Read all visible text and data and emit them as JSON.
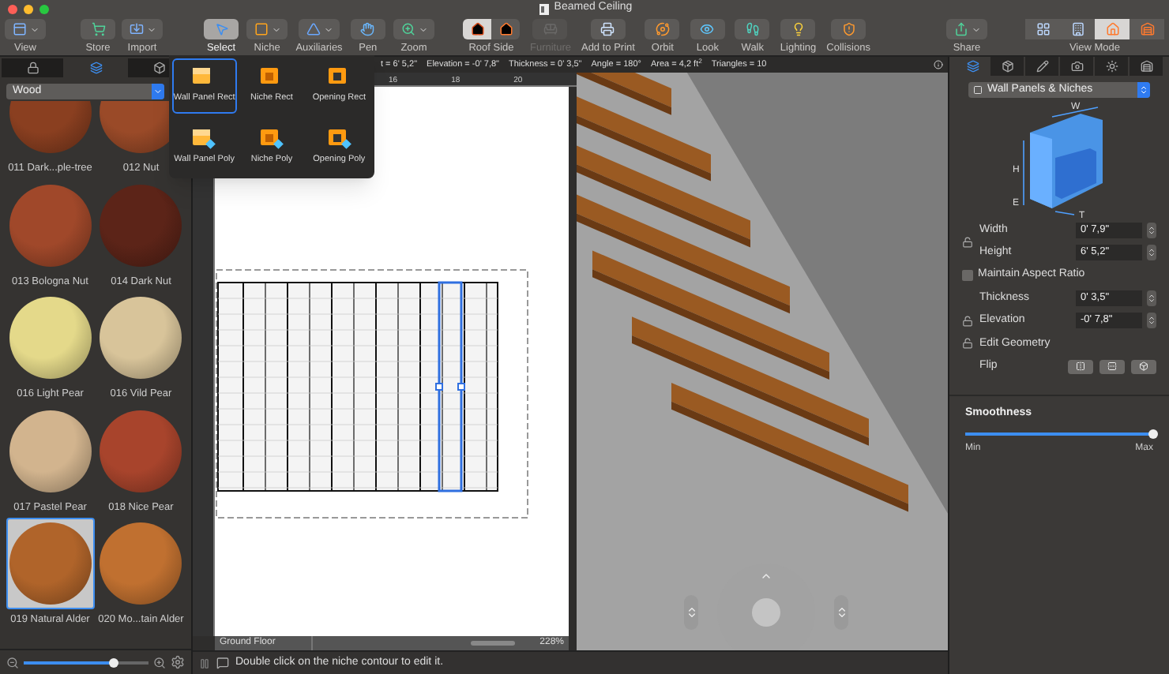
{
  "window": {
    "title": "Beamed Ceiling"
  },
  "toolbar_groups": [
    [
      {
        "label": "View",
        "kind": "view",
        "selected": false,
        "disabled": false
      }
    ],
    [
      {
        "label": "Store",
        "kind": "store",
        "selected": false,
        "disabled": false
      },
      {
        "label": "Import",
        "kind": "import",
        "selected": false,
        "disabled": false
      }
    ],
    [
      {
        "label": "Select",
        "kind": "select",
        "selected": true,
        "disabled": false
      },
      {
        "label": "Niche",
        "kind": "niche",
        "selected": false,
        "disabled": false
      },
      {
        "label": "Auxiliaries",
        "kind": "aux",
        "selected": false,
        "disabled": false
      },
      {
        "label": "Pen",
        "kind": "pen",
        "selected": false,
        "disabled": false
      },
      {
        "label": "Zoom",
        "kind": "zoom",
        "selected": false,
        "disabled": false
      }
    ],
    [
      {
        "label": "Roof Side",
        "kind": "roof",
        "selected": false,
        "disabled": false
      },
      {
        "label": "Furniture",
        "kind": "furniture",
        "selected": false,
        "disabled": true
      },
      {
        "label": "Add to Print",
        "kind": "print",
        "selected": false,
        "disabled": false
      },
      {
        "label": "Orbit",
        "kind": "orbit",
        "selected": false,
        "disabled": false
      },
      {
        "label": "Look",
        "kind": "look",
        "selected": false,
        "disabled": false
      },
      {
        "label": "Walk",
        "kind": "walk",
        "selected": false,
        "disabled": false
      },
      {
        "label": "Lighting",
        "kind": "lighting",
        "selected": false,
        "disabled": false
      },
      {
        "label": "Collisions",
        "kind": "collisions",
        "selected": false,
        "disabled": false
      }
    ],
    [
      {
        "label": "Share",
        "kind": "share",
        "selected": false,
        "disabled": false
      }
    ],
    [
      {
        "label": "View Mode",
        "kind": "viewmode",
        "selected": false,
        "disabled": false,
        "modes": [
          {
            "selected": false
          },
          {
            "selected": false
          },
          {
            "selected": true
          },
          {
            "selected": false
          }
        ]
      }
    ]
  ],
  "tool_popup": {
    "items": [
      {
        "label": "Wall Panel Rect",
        "kind": "panel",
        "polygon": false,
        "selected": true
      },
      {
        "label": "Niche Rect",
        "kind": "niche",
        "polygon": false,
        "selected": false
      },
      {
        "label": "Opening Rect",
        "kind": "opening",
        "polygon": false,
        "selected": false
      },
      {
        "label": "Wall Panel Poly",
        "kind": "panel",
        "polygon": true,
        "selected": false
      },
      {
        "label": "Niche Poly",
        "kind": "niche",
        "polygon": true,
        "selected": false
      },
      {
        "label": "Opening Poly",
        "kind": "opening",
        "polygon": true,
        "selected": false
      }
    ]
  },
  "library": {
    "tabs": [
      {
        "selected": false
      },
      {
        "selected": true
      },
      {
        "selected": false
      }
    ],
    "category": "Wood",
    "zoom": {
      "level": 0.72
    },
    "materials": [
      {
        "name": "011 Dark...ple-tree",
        "color": "#8a3f20",
        "selected": false
      },
      {
        "name": "012 Nut",
        "color": "#9a4a28",
        "selected": false
      },
      {
        "name": "013 Bologna Nut",
        "color": "#a0482a",
        "selected": false
      },
      {
        "name": "014 Dark Nut",
        "color": "#5c2418",
        "selected": false
      },
      {
        "name": "016 Light Pear",
        "color": "#e4d98a",
        "selected": false
      },
      {
        "name": "016 Vild Pear",
        "color": "#d8c49a",
        "selected": false
      },
      {
        "name": "017 Pastel Pear",
        "color": "#d2b48e",
        "selected": false
      },
      {
        "name": "018 Nice Pear",
        "color": "#a8442c",
        "selected": false
      },
      {
        "name": "019 Natural Alder",
        "color": "#b0642a",
        "selected": true
      },
      {
        "name": "020 Mo...tain Alder",
        "color": "#c07030",
        "selected": false
      }
    ]
  },
  "info_bar": {
    "readouts": [
      "t = 6' 5,2\"",
      "Elevation = -0' 7,8\"",
      "Thickness = 0' 3,5\"",
      "Angle = 180°",
      "Area = 4,2 ft$^{2}$",
      "Triangles = 10"
    ]
  },
  "plan": {
    "ruler_labels": [
      "16",
      "18",
      "20"
    ],
    "floor": "Ground Floor",
    "zoom": "228%"
  },
  "status_bar": {
    "message": "Double click on the niche contour to edit it."
  },
  "inspector": {
    "tabs": [
      {
        "selected": true
      },
      {
        "selected": false
      },
      {
        "selected": false
      },
      {
        "selected": false
      },
      {
        "selected": false
      },
      {
        "selected": false
      }
    ],
    "object_type": "Wall Panels & Niches",
    "diagram_labels": [
      "W",
      "H",
      "E",
      "T"
    ],
    "width": {
      "label": "Width",
      "value": "0' 7,9\""
    },
    "height": {
      "label": "Height",
      "value": "6' 5,2\""
    },
    "aspect": {
      "label": "Maintain Aspect Ratio",
      "checked": false
    },
    "thickness": {
      "label": "Thickness",
      "value": "0' 3,5\""
    },
    "elevation": {
      "label": "Elevation",
      "value": "-0' 7,8\""
    },
    "edit_geometry": {
      "label": "Edit Geometry"
    },
    "flip": {
      "label": "Flip"
    },
    "smoothness": {
      "label": "Smoothness",
      "level": 1,
      "min": "Min",
      "max": "Max"
    }
  }
}
